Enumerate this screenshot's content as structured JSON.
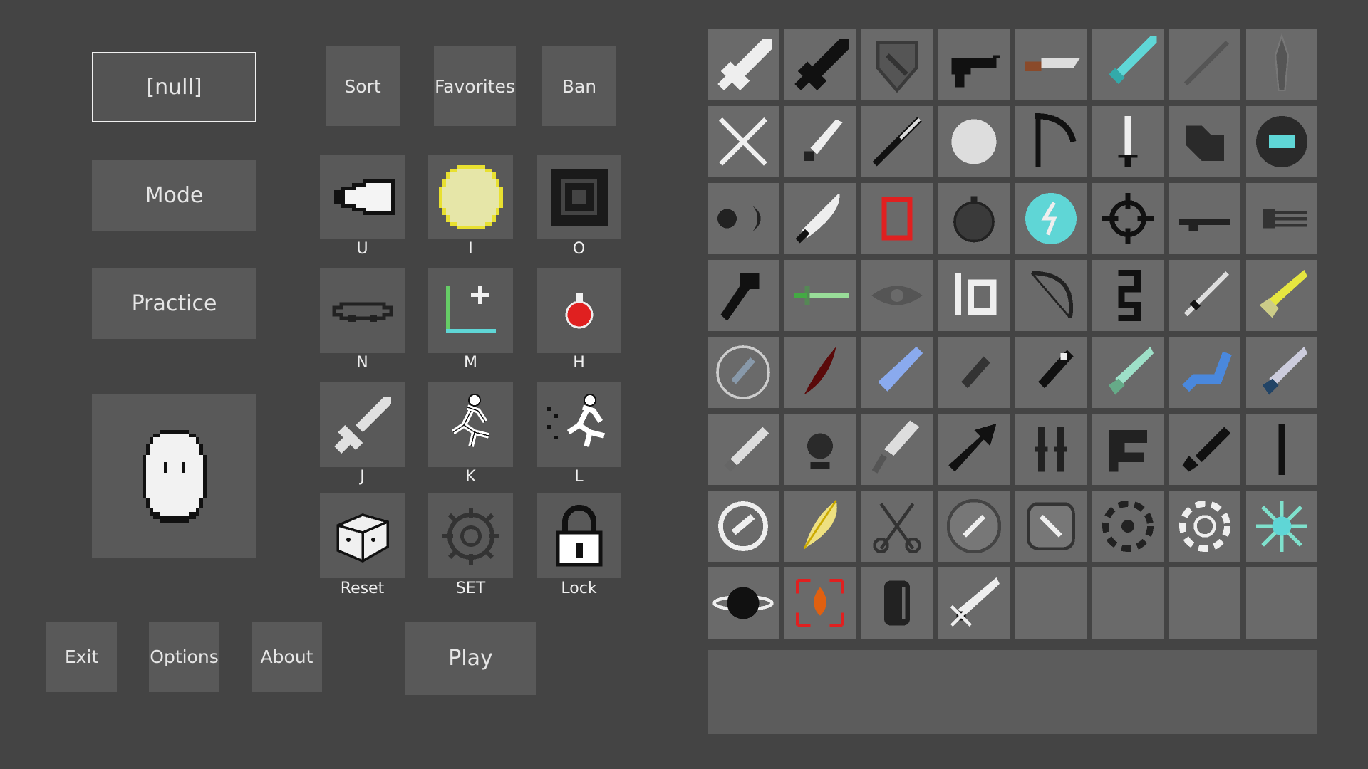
{
  "left_menu": {
    "name_value": "[null]",
    "mode_label": "Mode",
    "practice_label": "Practice"
  },
  "top_buttons": {
    "sort": "Sort",
    "favorites": "Favorites",
    "ban": "Ban"
  },
  "keybinds": [
    {
      "key": "U",
      "icon": "bullet-icon"
    },
    {
      "key": "I",
      "icon": "yellow-orb-icon"
    },
    {
      "key": "O",
      "icon": "target-square-icon"
    },
    {
      "key": "N",
      "icon": "chain-ring-icon"
    },
    {
      "key": "M",
      "icon": "add-corner-icon"
    },
    {
      "key": "H",
      "icon": "red-potion-icon"
    },
    {
      "key": "J",
      "icon": "sword-icon"
    },
    {
      "key": "K",
      "icon": "runner-icon"
    },
    {
      "key": "L",
      "icon": "dash-runner-icon"
    },
    {
      "key": "Reset",
      "icon": "dice-icon"
    },
    {
      "key": "SET",
      "icon": "gear-icon"
    },
    {
      "key": "Lock",
      "icon": "padlock-icon"
    }
  ],
  "bottom_buttons": {
    "exit": "Exit",
    "options": "Options",
    "about": "About",
    "play": "Play"
  },
  "colors": {
    "background": "#444444",
    "button": "#595959",
    "cell": "#6a6a6a",
    "accent_cyan": "#5fd6d6",
    "accent_yellow": "#e6e680",
    "accent_red": "#e02020"
  },
  "weapon_grid": [
    "white-sword-icon",
    "black-sword-icon",
    "shield-icon",
    "revolver-icon",
    "knife-icon",
    "cyan-sword-icon",
    "thin-blade-icon",
    "spear-tip-icon",
    "crossed-arrows-icon",
    "dagger-icon",
    "katana-icon",
    "white-orb-icon",
    "scythe-icon",
    "candle-sword-icon",
    "black-blob-icon",
    "black-ring-icon",
    "dot-crescent-icon",
    "curved-blade-icon",
    "red-frame-icon",
    "bomb-icon",
    "lightning-orb-icon",
    "crosshair-icon",
    "shotgun-icon",
    "minigun-icon",
    "hammer-icon",
    "green-sword-icon",
    "eye-icon",
    "io-icon",
    "bow-icon",
    "glyph-icon",
    "long-sword-icon",
    "golden-sword-icon",
    "circle-sword-icon",
    "red-claw-icon",
    "blue-dagger-icon",
    "dark-dagger-icon",
    "black-knife-icon",
    "mint-sword-icon",
    "blue-blade-icon",
    "steel-blade-icon",
    "grey-dagger-icon",
    "black-flower-icon",
    "cleaver-icon",
    "arrow-icon",
    "twin-blades-icon",
    "fist-icon",
    "black-sword-small-icon",
    "black-staff-icon",
    "swirl-orb-icon",
    "yellow-feather-icon",
    "scissors-icon",
    "circle-sword-2-icon",
    "framed-sword-icon",
    "black-hole-icon",
    "white-vortex-icon",
    "cyan-burst-icon",
    "planet-icon",
    "fire-target-icon",
    "black-rune-icon",
    "crossed-sword-icon",
    "empty",
    "empty",
    "empty",
    "empty"
  ]
}
